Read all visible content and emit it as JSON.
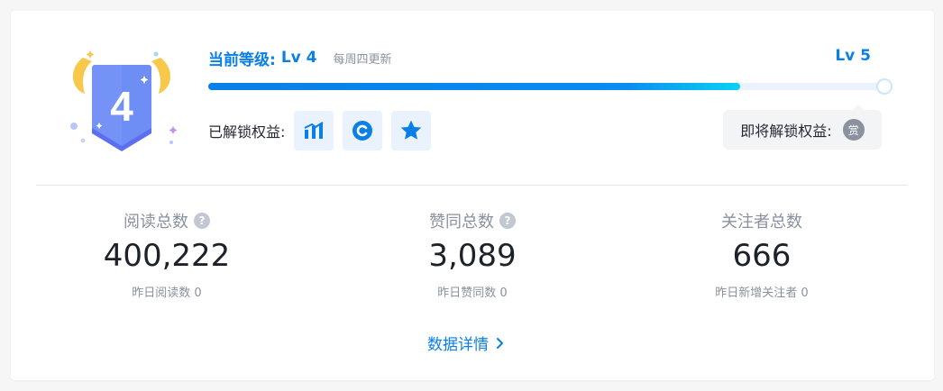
{
  "level": {
    "current_label": "当前等级:",
    "current_value": "Lv 4",
    "update_note": "每周四更新",
    "next_value": "Lv 5",
    "badge_number": "4",
    "progress_fraction": 0.787
  },
  "perks": {
    "unlocked_label": "已解锁权益:",
    "items": [
      {
        "icon": "chart-icon"
      },
      {
        "icon": "copyright-icon"
      },
      {
        "icon": "star-icon"
      }
    ],
    "upcoming_label": "即将解锁权益:",
    "upcoming_icon_text": "赏"
  },
  "stats": [
    {
      "title": "阅读总数",
      "value": "400,222",
      "sub": "昨日阅读数 0",
      "help": "?"
    },
    {
      "title": "赞同总数",
      "value": "3,089",
      "sub": "昨日赞同数 0",
      "help": "?"
    },
    {
      "title": "关注者总数",
      "value": "666",
      "sub": "昨日新增关注者 0"
    }
  ],
  "detail_link": "数据详情",
  "colors": {
    "accent": "#0a7fe6",
    "progress_end": "#09d2f2",
    "badge": "#5b7cf0",
    "wings": "#f8c84a"
  }
}
